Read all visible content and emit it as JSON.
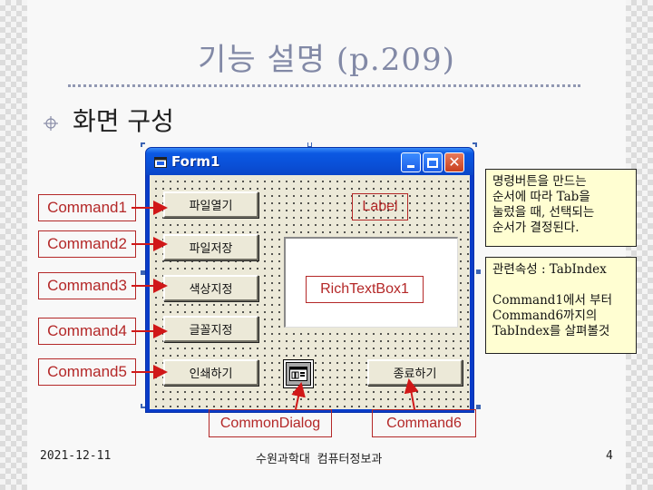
{
  "slide": {
    "title": "기능 설명 (p.209)",
    "subtitle": "화면 구성",
    "bullet_icon": "crosshair-bullet-icon"
  },
  "form": {
    "title": "Form1",
    "title_icon": "form-window-icon",
    "controls": {
      "minimize_icon": "minimize-icon",
      "maximize_icon": "maximize-icon",
      "close_glyph": "✕"
    },
    "buttons": [
      {
        "name": "Command1",
        "label": "파일열기"
      },
      {
        "name": "Command2",
        "label": "파일저장"
      },
      {
        "name": "Command3",
        "label": "색상지정"
      },
      {
        "name": "Command4",
        "label": "글꼴지정"
      },
      {
        "name": "Command5",
        "label": "인쇄하기"
      },
      {
        "name": "Command6",
        "label": "종료하기"
      }
    ],
    "label_control": "Label",
    "richtextbox": "RichTextBox1",
    "commondialog_icon": "common-dialog-icon"
  },
  "callouts": {
    "command1": "Command1",
    "command2": "Command2",
    "command3": "Command3",
    "command4": "Command4",
    "command5": "Command5",
    "command6": "Command6",
    "commondialog": "CommonDialog",
    "label": "Label",
    "richtextbox": "RichTextBox1"
  },
  "notes": {
    "note1_lines": [
      "명령버튼을 만드는",
      "순서에 따라 Tab을",
      "눌렀을 때, 선택되는",
      "순서가 결정된다."
    ],
    "note2_lines": [
      "관련속성 : TabIndex",
      "",
      "Command1에서 부터",
      "Command6까지의",
      "TabIndex를 살펴볼것"
    ]
  },
  "footer": {
    "date": "2021-12-11",
    "organization": "수원과학대 컴퓨터정보과",
    "page_number": "4"
  },
  "colors": {
    "title": "#8289a6",
    "callout": "#b42828",
    "arrow": "#d01818",
    "titlebar": "#0b58e2",
    "form_bg": "#ece9d8",
    "note_bg": "#fffed2"
  }
}
